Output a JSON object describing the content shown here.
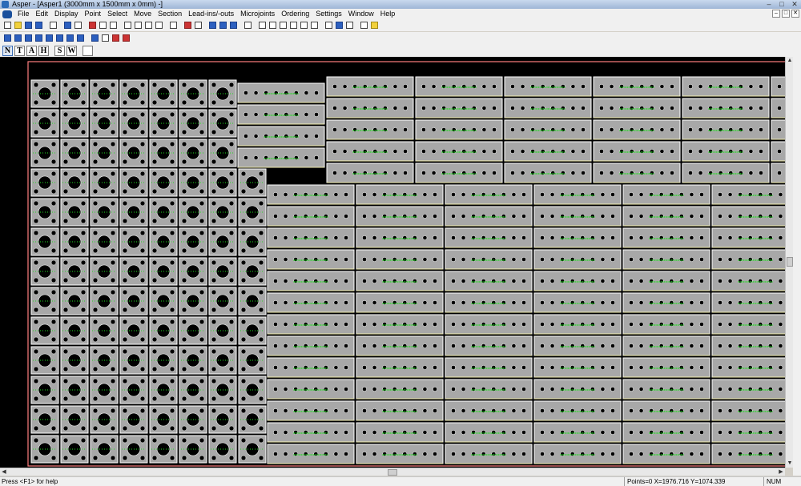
{
  "window": {
    "title": "Asper - [Asper1  (3000mm x 1500mm x 0mm) -]",
    "minimize": "–",
    "maximize": "□",
    "close": "✕"
  },
  "menu": {
    "items": [
      "File",
      "Edit",
      "Display",
      "Point",
      "Select",
      "Move",
      "Section",
      "Lead-ins/-outs",
      "Microjoints",
      "Ordering",
      "Settings",
      "Window",
      "Help"
    ]
  },
  "toolbar3": {
    "letters": [
      "N",
      "T",
      "A",
      "H",
      "S",
      "W"
    ]
  },
  "icons": {
    "app": "asper-app-icon",
    "toolbar1": [
      "new-file-icon",
      "open-folder-icon",
      "save-icon",
      "save-as-icon",
      "print-icon",
      "select-arrow-icon",
      "undo-arrow-icon",
      "add-part-icon",
      "copy-part-icon",
      "delete-part-icon",
      "zoom-in-icon",
      "zoom-out-icon",
      "zoom-window-icon",
      "grid-icon",
      "help-icon",
      "copy-icon",
      "paste-icon",
      "move-cross-icon",
      "rotate-left-icon",
      "rotate-right-icon",
      "measure-icon",
      "zoom-part-icon",
      "zoom-prev-icon",
      "zoom-all-icon",
      "zoom-sheet-icon",
      "zoom-fit-icon",
      "zoom-page-icon",
      "cut-icon",
      "nest-icon",
      "delete-nest-icon",
      "sheet-icon",
      "note-icon"
    ],
    "toolbar2": [
      "dots-grid-1-icon",
      "dots-grid-2-icon",
      "dots-grid-3-icon",
      "dots-grid-4-icon",
      "dots-grid-5-icon",
      "dots-grid-6-icon",
      "dots-grid-7-icon",
      "dots-grid-8-icon",
      "first-icon",
      "back-icon",
      "stamp-icon",
      "layers-icon"
    ]
  },
  "colors": {
    "canvas_bg": "#000000",
    "part_fill": "#a8a8a8",
    "part_border": "#ffffff",
    "sheet_border": "#ff7f7f",
    "leadin_green": "#22dd22",
    "hole_black": "#000000",
    "microjoint_yellow": "#e8e060"
  },
  "status": {
    "help": "Press <F1> for help",
    "coords": "Points=0 X=1976.716 Y=1074.339",
    "num": "NUM"
  }
}
